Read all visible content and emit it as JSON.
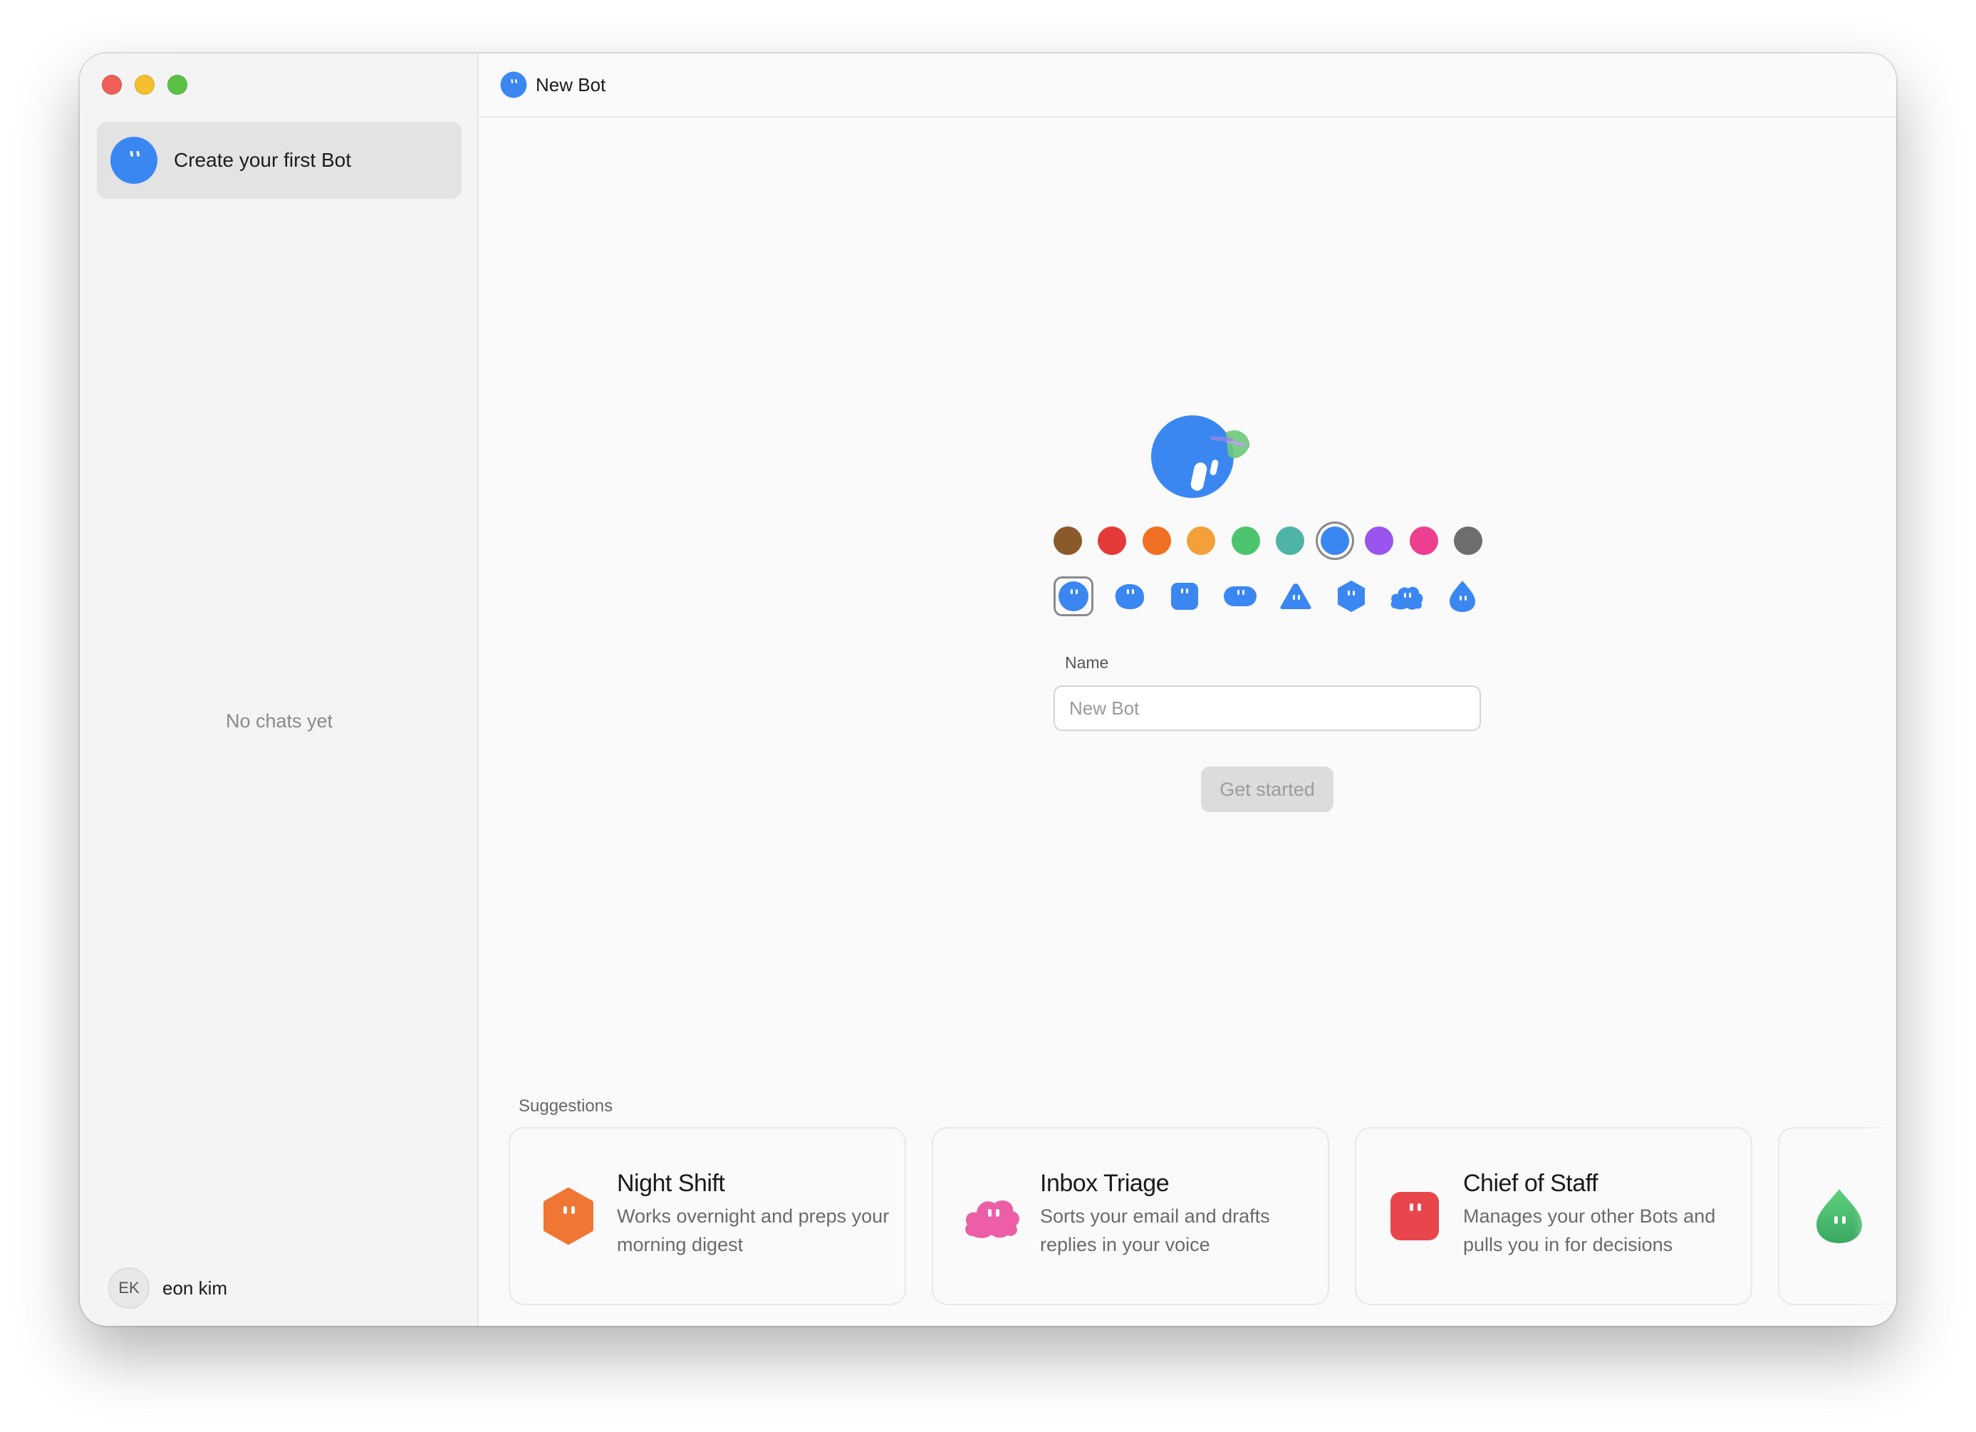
{
  "sidebar": {
    "active_item": {
      "label": "Create your first Bot",
      "icon": "blob-bot-icon",
      "color": "#3b87f2"
    },
    "empty_state": "No chats yet",
    "user": {
      "initials": "EK",
      "name": "eon kim"
    }
  },
  "header": {
    "title": "New Bot",
    "icon": "blob-bot-icon"
  },
  "editor": {
    "color_options": [
      "#8b5a2b",
      "#e63a3a",
      "#f07022",
      "#f3a03a",
      "#4cc46e",
      "#4db4a6",
      "#3b87f2",
      "#9a55ee",
      "#ec3f8f",
      "#6e6e6e"
    ],
    "selected_color": "#3b87f2",
    "shape_options": [
      "circle",
      "blob",
      "square",
      "pill",
      "triangle",
      "hexagon",
      "cloud",
      "drop"
    ],
    "selected_shape": "circle",
    "name_label": "Name",
    "name_placeholder": "New Bot",
    "name_value": "",
    "submit_label": "Get started"
  },
  "suggestions": {
    "label": "Suggestions",
    "items": [
      {
        "title": "Night Shift",
        "description": "Works overnight and preps your morning digest",
        "shape": "hexagon",
        "color": "#f07633"
      },
      {
        "title": "Inbox Triage",
        "description": "Sorts your email and drafts replies in your voice",
        "shape": "cloud",
        "color": "#ec5fa6"
      },
      {
        "title": "Chief of Staff",
        "description": "Manages your other Bots and pulls you in for decisions",
        "shape": "square",
        "color": "#e8464c"
      },
      {
        "title": "",
        "description": "",
        "shape": "drop",
        "color": "#4cc46e"
      }
    ]
  }
}
